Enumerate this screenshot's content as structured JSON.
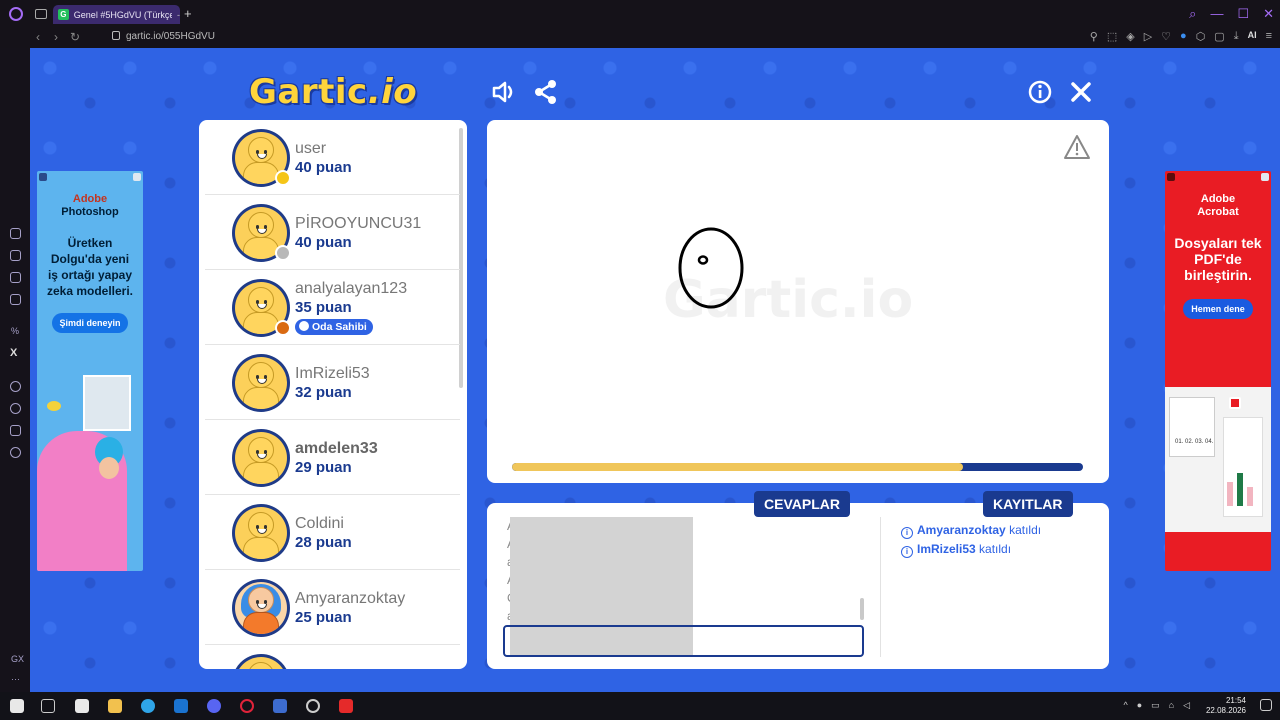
{
  "browser": {
    "tab_title": "Genel #5HGdVU (Türkçe)",
    "tab_close": "-",
    "new_tab": "+",
    "url": "gartic.io/055HGdVU",
    "ai_label": "AI"
  },
  "game": {
    "logo_main": "Gartic",
    "logo_suffix": ".io",
    "watermark_main": "Gartic",
    "watermark_suffix": ".io"
  },
  "players": [
    {
      "name": "user",
      "score": "40 puan",
      "badge_color": "#f5c518",
      "bold": false,
      "avatar": "boy"
    },
    {
      "name": "PİROOYUNCU31",
      "score": "40 puan",
      "badge_color": "#b8b8b8",
      "bold": false,
      "avatar": "boy"
    },
    {
      "name": "analyalayan123",
      "score": "35 puan",
      "badge_color": "#d96a12",
      "bold": false,
      "avatar": "boy",
      "tag": "Oda Sahibi"
    },
    {
      "name": "ImRizeli53",
      "score": "32 puan",
      "bold": false,
      "avatar": "boy"
    },
    {
      "name": "amdelen33",
      "score": "29 puan",
      "bold": true,
      "avatar": "boy"
    },
    {
      "name": "Coldini",
      "score": "28 puan",
      "bold": false,
      "avatar": "boy"
    },
    {
      "name": "Amyaranzoktay",
      "score": "25 puan",
      "bold": false,
      "avatar": "girl"
    }
  ],
  "board": {
    "timer_remaining": 0.79
  },
  "panel": {
    "answers_tab": "CEVAPLAR",
    "logs_tab": "KAYITLAR",
    "answer_lines": [
      "A",
      "A",
      "a",
      "A",
      "C",
      "a"
    ],
    "logs": [
      {
        "user": "Amyaranzoktay",
        "action": "katıldı"
      },
      {
        "user": "ImRizeli53",
        "action": "katıldı"
      }
    ]
  },
  "ads": {
    "left": {
      "brand_1": "Adobe",
      "brand_2": "Photoshop",
      "text": "Üretken Dolgu'da yeni iş ortağı yapay zeka modelleri.",
      "cta": "Şimdi deneyin"
    },
    "right": {
      "brand_1": "Adobe",
      "brand_2": "Acrobat",
      "text": "Dosyaları tek PDF'de birleştirin.",
      "cta": "Hemen dene",
      "doc_label": "01. 02. 03. 04."
    }
  },
  "taskbar": {
    "time": "21:54",
    "date": "22.08.2026"
  },
  "colors": {
    "game_bg": "#2f63e4",
    "navy": "#1a3a8f",
    "timer_fill": "#f0c65a"
  }
}
